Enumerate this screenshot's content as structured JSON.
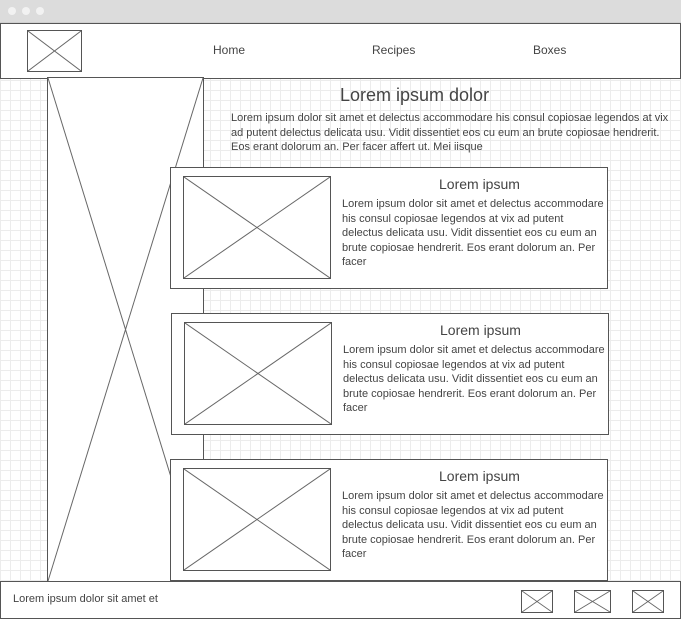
{
  "nav": [
    "Home",
    "Recipes",
    "Boxes"
  ],
  "main": {
    "title": "Lorem ipsum dolor",
    "intro": "Lorem ipsum dolor sit amet et delectus accommodare his consul copiosae legendos at vix ad putent delectus delicata usu. Vidit dissentiet eos cu eum an brute copiosae hendrerit. Eos erant dolorum an. Per facer affert ut. Mei iisque"
  },
  "cards": [
    {
      "title": "Lorem ipsum",
      "text": "Lorem ipsum dolor sit amet et delectus accommodare his consul copiosae legendos at vix ad putent delectus delicata usu. Vidit dissentiet eos cu eum an brute copiosae hendrerit. Eos erant dolorum an. Per facer"
    },
    {
      "title": "Lorem ipsum",
      "text": "Lorem ipsum dolor sit amet et delectus accommodare his consul copiosae legendos at vix ad putent delectus delicata usu. Vidit dissentiet eos cu eum an brute copiosae hendrerit. Eos erant dolorum an. Per facer"
    },
    {
      "title": "Lorem ipsum",
      "text": "Lorem ipsum dolor sit amet et delectus accommodare his consul copiosae legendos at vix ad putent delectus delicata usu. Vidit dissentiet eos cu eum an brute copiosae hendrerit. Eos erant dolorum an. Per facer"
    }
  ],
  "footer": {
    "text": "Lorem ipsum dolor sit amet et"
  }
}
